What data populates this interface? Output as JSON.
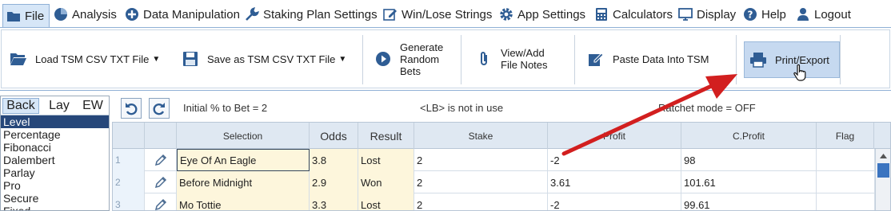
{
  "menu": {
    "items": [
      {
        "label": "File",
        "icon": "folder-icon",
        "active": true
      },
      {
        "label": "Analysis",
        "icon": "chart-icon"
      },
      {
        "label": "Data Manipulation",
        "icon": "plus-circle-icon"
      },
      {
        "label": "Staking Plan Settings",
        "icon": "wrench-icon"
      },
      {
        "label": "Win/Lose Strings",
        "icon": "edit-icon"
      },
      {
        "label": "App Settings",
        "icon": "gear-icon"
      },
      {
        "label": "Calculators",
        "icon": "calculator-icon"
      },
      {
        "label": "Display",
        "icon": "monitor-icon"
      },
      {
        "label": "Help",
        "icon": "question-icon"
      },
      {
        "label": "Logout",
        "icon": "user-icon"
      }
    ]
  },
  "ribbon": {
    "load": "Load TSM CSV TXT File",
    "save": "Save as TSM CSV TXT File",
    "generate": [
      "Generate",
      "Random",
      "Bets"
    ],
    "notes": [
      "View/Add",
      "File Notes"
    ],
    "paste": "Paste Data Into TSM",
    "print": "Print/Export"
  },
  "bet_type_tabs": [
    "Back",
    "Lay",
    "EW"
  ],
  "staking_types": [
    "Level",
    "Percentage",
    "Fibonacci",
    "Dalembert",
    "Parlay",
    "Pro",
    "Secure",
    "Fixed"
  ],
  "status": {
    "initial": "Initial % to Bet = 2",
    "lb": "<LB> is not in use",
    "ratchet": "Ratchet mode = OFF"
  },
  "grid": {
    "columns": [
      "",
      "",
      "Selection",
      "Odds",
      "Result",
      "Stake",
      "Profit",
      "C.Profit",
      "Flag"
    ],
    "rows": [
      {
        "n": "1",
        "selection": "Eye Of An Eagle",
        "odds": "3.8",
        "result": "Lost",
        "stake": "2",
        "profit": "-2",
        "cprofit": "98",
        "flag": ""
      },
      {
        "n": "2",
        "selection": "Before Midnight",
        "odds": "2.9",
        "result": "Won",
        "stake": "2",
        "profit": "3.61",
        "cprofit": "101.61",
        "flag": ""
      },
      {
        "n": "3",
        "selection": "Mo Tottie",
        "odds": "3.3",
        "result": "Lost",
        "stake": "2",
        "profit": "-2",
        "cprofit": "99.61",
        "flag": ""
      }
    ]
  },
  "colors": {
    "accent": "#26477a",
    "annotation_arrow": "#d21f1f",
    "scroll_thumb": "#3b74c0"
  }
}
